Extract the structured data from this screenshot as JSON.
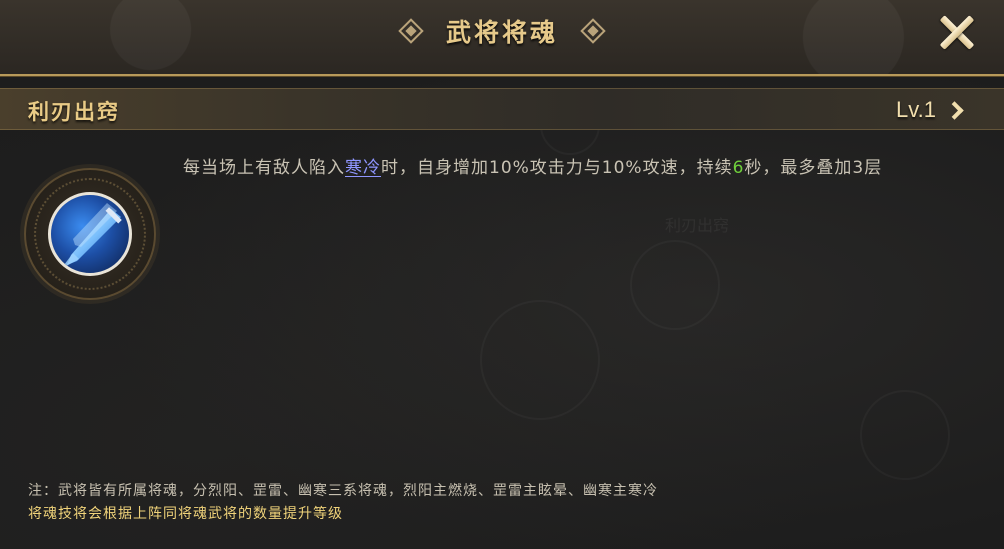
{
  "header": {
    "title": "武将将魂"
  },
  "skill": {
    "name": "利刃出窍",
    "level": "Lv.1"
  },
  "description": {
    "part1": "每当场上有敌人陷入",
    "keyword_cold": "寒冷",
    "part2": "时，自身增加10%攻击力与10%攻速，持续",
    "duration": "6",
    "part3": "秒，最多叠加3层"
  },
  "notes": {
    "note1": "注：武将皆有所属将魂，分烈阳、罡雷、幽寒三系将魂，烈阳主燃烧、罡雷主眩晕、幽寒主寒冷",
    "note2": "将魂技将会根据上阵同将魂武将的数量提升等级"
  },
  "background_ghost": {
    "skill_name": "利刃出窍"
  },
  "colors": {
    "title_gold": "#e6c98a",
    "keyword_blue": "#8f96ff",
    "number_green": "#6fcf3c",
    "note_yellow": "#f0d37a"
  },
  "icons": {
    "close": "close-icon",
    "chevron": "chevron-right-icon",
    "skill": "sword-skill-icon"
  }
}
